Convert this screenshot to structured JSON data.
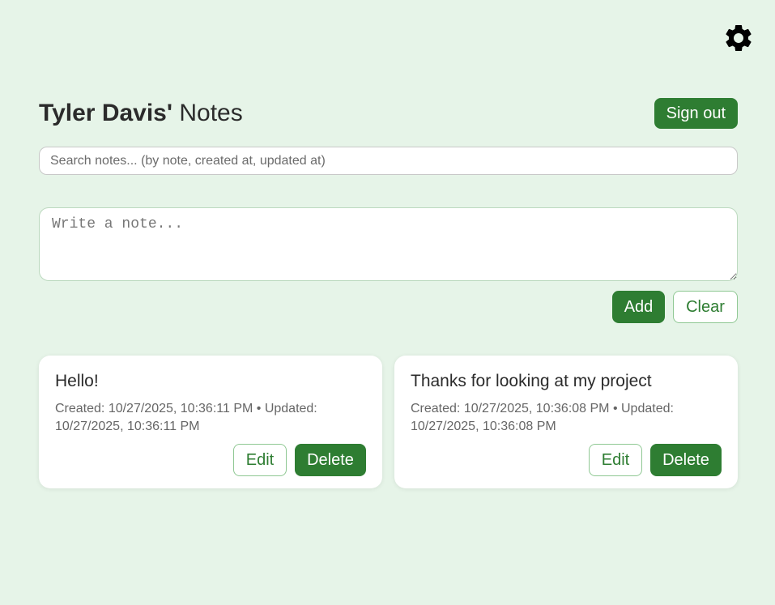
{
  "header": {
    "user_name": "Tyler Davis'",
    "title_suffix": "Notes",
    "signout_label": "Sign out"
  },
  "icons": {
    "settings": "gear-icon"
  },
  "search": {
    "placeholder": "Search notes... (by note, created at, updated at)",
    "value": ""
  },
  "composer": {
    "placeholder": "Write a note...",
    "value": "",
    "add_label": "Add",
    "clear_label": "Clear"
  },
  "notes": [
    {
      "text": "Hello!",
      "meta": "Created: 10/27/2025, 10:36:11 PM • Updated: 10/27/2025, 10:36:11 PM",
      "edit_label": "Edit",
      "delete_label": "Delete"
    },
    {
      "text": "Thanks for looking at my project",
      "meta": "Created: 10/27/2025, 10:36:08 PM • Updated: 10/27/2025, 10:36:08 PM",
      "edit_label": "Edit",
      "delete_label": "Delete"
    }
  ],
  "colors": {
    "background": "#e6f4e8",
    "primary": "#2e7d32",
    "card": "#ffffff"
  }
}
